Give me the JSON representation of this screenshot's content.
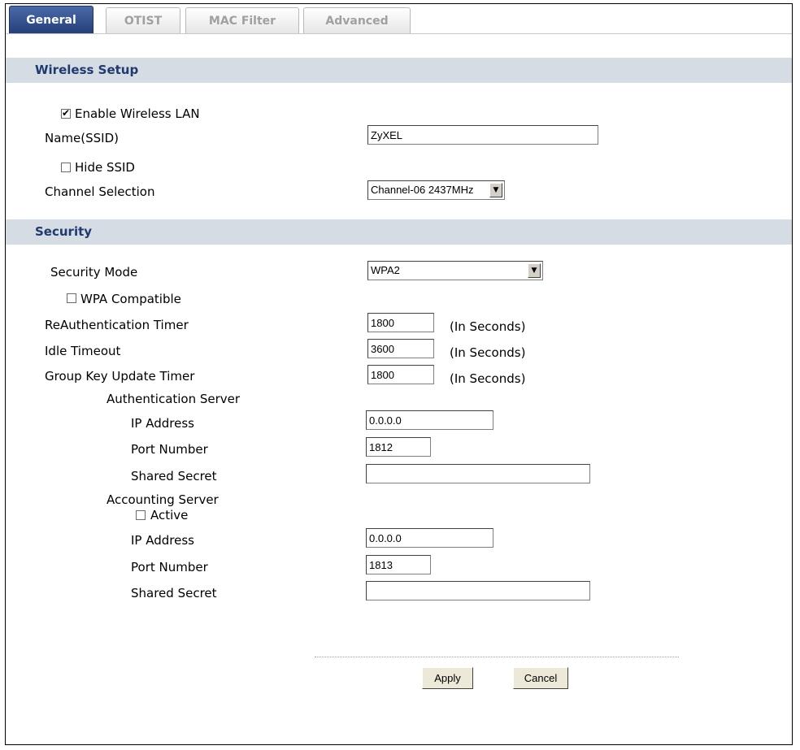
{
  "tabs": [
    "General",
    "OTIST",
    "MAC Filter",
    "Advanced"
  ],
  "wireless": {
    "title": "Wireless Setup",
    "enable_label": "Enable Wireless LAN",
    "enable_checked": true,
    "ssid_label": "Name(SSID)",
    "ssid_value": "ZyXEL",
    "hide_label": "Hide SSID",
    "hide_checked": false,
    "channel_label": "Channel Selection",
    "channel_value": "Channel-06 2437MHz"
  },
  "security": {
    "title": "Security",
    "mode_label": "Security Mode",
    "mode_value": "WPA2",
    "wpa_compat_label": "WPA Compatible",
    "wpa_compat_checked": false,
    "reauth_label": "ReAuthentication Timer",
    "reauth_value": "1800",
    "idle_label": "Idle Timeout",
    "idle_value": "3600",
    "gkey_label": "Group Key Update Timer",
    "gkey_value": "1800",
    "unit": "(In Seconds)",
    "auth_server": {
      "title": "Authentication Server",
      "ip_label": "IP Address",
      "ip_value": "0.0.0.0",
      "port_label": "Port Number",
      "port_value": "1812",
      "secret_label": "Shared Secret",
      "secret_value": ""
    },
    "acct_server": {
      "title": "Accounting Server",
      "active_label": "Active",
      "active_checked": false,
      "ip_label": "IP Address",
      "ip_value": "0.0.0.0",
      "port_label": "Port Number",
      "port_value": "1813",
      "secret_label": "Shared Secret",
      "secret_value": ""
    }
  },
  "buttons": {
    "apply": "Apply",
    "cancel": "Cancel"
  }
}
